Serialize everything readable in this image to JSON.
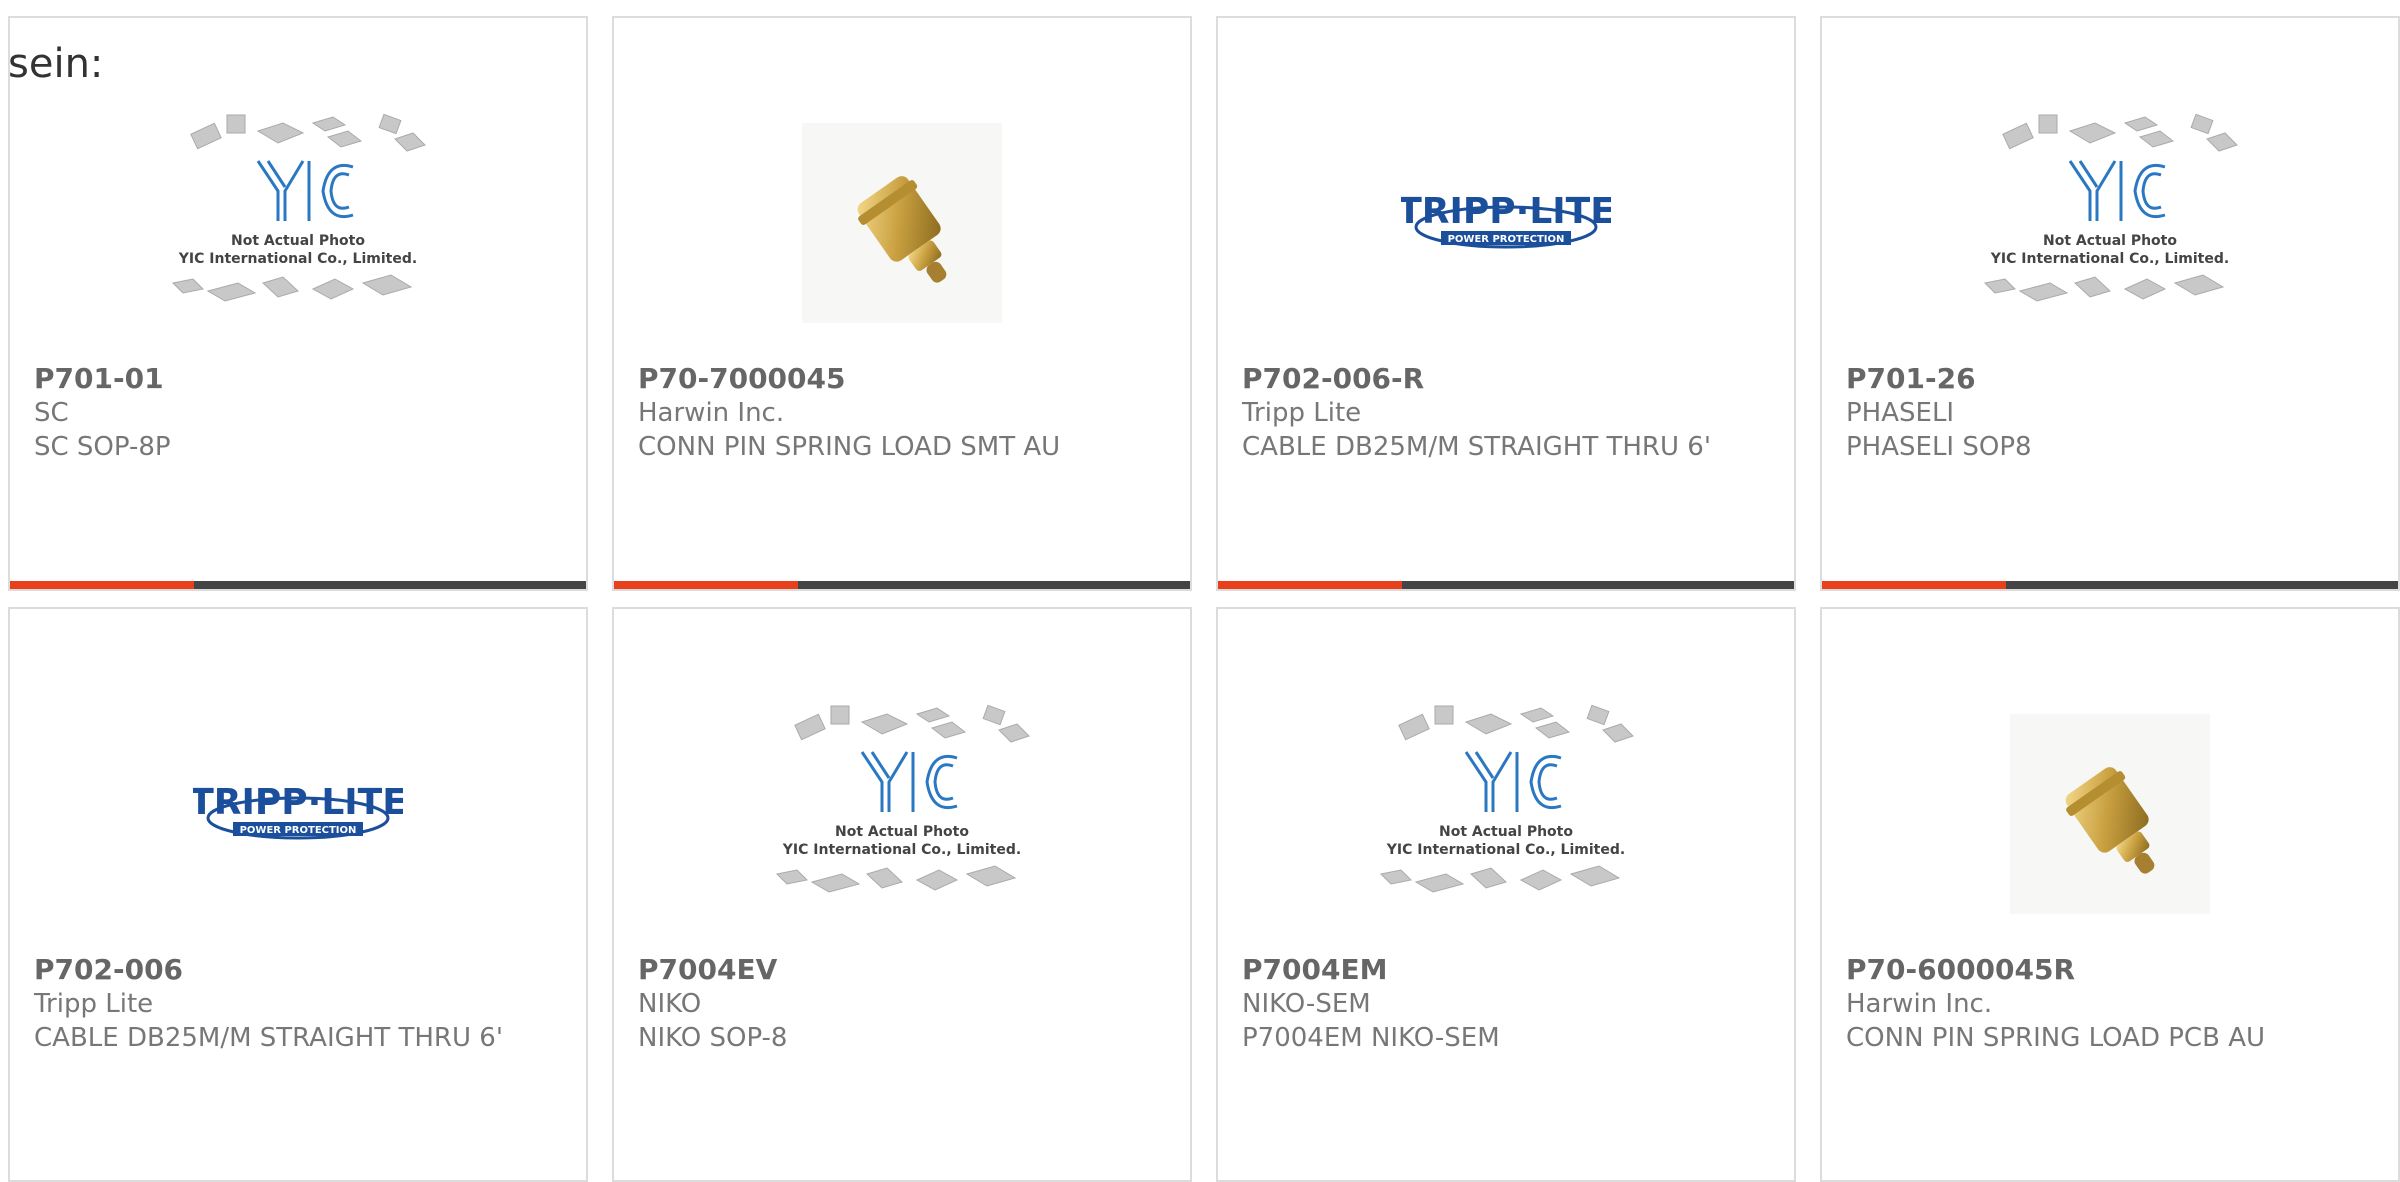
{
  "heading": "sein:",
  "accent_color": "#e8401c",
  "bar_color": "#444444",
  "placeholder_image": {
    "line1": "Not Actual Photo",
    "line2": "YIC International Co., Limited.",
    "logo": "YIC"
  },
  "tripp_lite_logo": {
    "name": "TRIPP·LITE",
    "tagline": "POWER PROTECTION"
  },
  "products": [
    {
      "part": "P701-01",
      "maker": "SC",
      "desc": "SC SOP-8P",
      "image": "yic-placeholder",
      "progress": 0.32
    },
    {
      "part": "P70-7000045",
      "maker": "Harwin Inc.",
      "desc": "CONN PIN SPRING LOAD SMT AU",
      "image": "connector-pin",
      "progress": 0.32
    },
    {
      "part": "P702-006-R",
      "maker": "Tripp Lite",
      "desc": "CABLE DB25M/M STRAIGHT THRU 6'",
      "image": "tripp-lite-logo",
      "progress": 0.32
    },
    {
      "part": "P701-26",
      "maker": "PHASELI",
      "desc": "PHASELI SOP8",
      "image": "yic-placeholder",
      "progress": 0.32
    },
    {
      "part": "P702-006",
      "maker": "Tripp Lite",
      "desc": "CABLE DB25M/M STRAIGHT THRU 6'",
      "image": "tripp-lite-logo",
      "progress": null
    },
    {
      "part": "P7004EV",
      "maker": "NIKO",
      "desc": "NIKO SOP-8",
      "image": "yic-placeholder",
      "progress": null
    },
    {
      "part": "P7004EM",
      "maker": "NIKO-SEM",
      "desc": "P7004EM NIKO-SEM",
      "image": "yic-placeholder",
      "progress": null
    },
    {
      "part": "P70-6000045R",
      "maker": "Harwin Inc.",
      "desc": "CONN PIN SPRING LOAD PCB AU",
      "image": "connector-pin",
      "progress": null
    }
  ]
}
